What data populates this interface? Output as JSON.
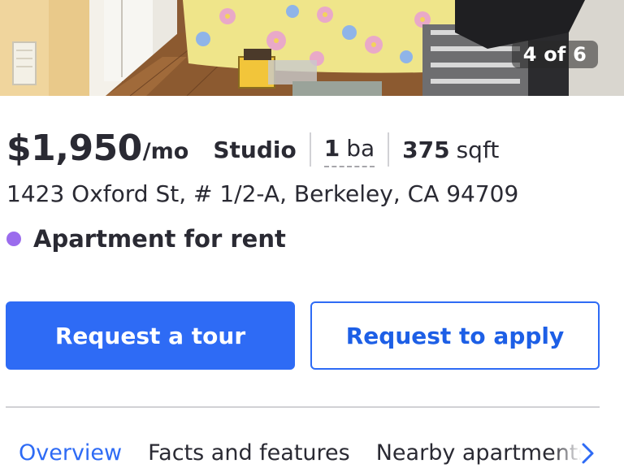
{
  "photo": {
    "counter": "4 of 6"
  },
  "listing": {
    "price": "$1,950",
    "price_unit": "/mo",
    "beds": "Studio",
    "baths_value": "1",
    "baths_unit": "ba",
    "sqft_value": "375",
    "sqft_unit": "sqft",
    "address": "1423 Oxford St, # 1/2-A, Berkeley, CA 94709",
    "status": "Apartment for rent",
    "status_color": "#9b6ced"
  },
  "actions": {
    "tour_label": "Request a tour",
    "apply_label": "Request to apply",
    "primary_color": "#2e6bf5"
  },
  "tabs": [
    {
      "label": "Overview",
      "active": true
    },
    {
      "label": "Facts and features",
      "active": false
    },
    {
      "label": "Nearby apartments",
      "active": false
    }
  ],
  "icons": {
    "tabs_scroll": "chevron-right-icon",
    "status": "status-dot-icon"
  }
}
